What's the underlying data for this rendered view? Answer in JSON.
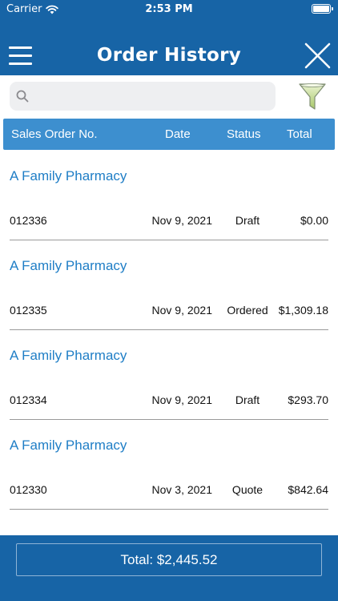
{
  "status_bar": {
    "carrier": "Carrier",
    "time": "2:53 PM"
  },
  "nav": {
    "title": "Order History",
    "menu_icon": "hamburger-icon",
    "close_icon": "close-icon"
  },
  "search": {
    "placeholder": "",
    "value": "",
    "icon": "search-icon",
    "filter_icon": "filter-funnel-icon"
  },
  "table": {
    "headers": {
      "order_no": "Sales Order No.",
      "date": "Date",
      "status": "Status",
      "total": "Total"
    },
    "orders": [
      {
        "customer": "A Family Pharmacy",
        "order_no": "012336",
        "date": "Nov 9, 2021",
        "status": "Draft",
        "total": "$0.00"
      },
      {
        "customer": "A Family Pharmacy",
        "order_no": "012335",
        "date": "Nov 9, 2021",
        "status": "Ordered",
        "total": "$1,309.18"
      },
      {
        "customer": "A Family Pharmacy",
        "order_no": "012334",
        "date": "Nov 9, 2021",
        "status": "Draft",
        "total": "$293.70"
      },
      {
        "customer": "A Family Pharmacy",
        "order_no": "012330",
        "date": "Nov 3, 2021",
        "status": "Quote",
        "total": "$842.64"
      }
    ]
  },
  "footer": {
    "total_label": "Total: $2,445.52"
  },
  "colors": {
    "nav_bg": "#1764a6",
    "header_bg": "#3d8fcf",
    "link": "#1f7ec6"
  }
}
